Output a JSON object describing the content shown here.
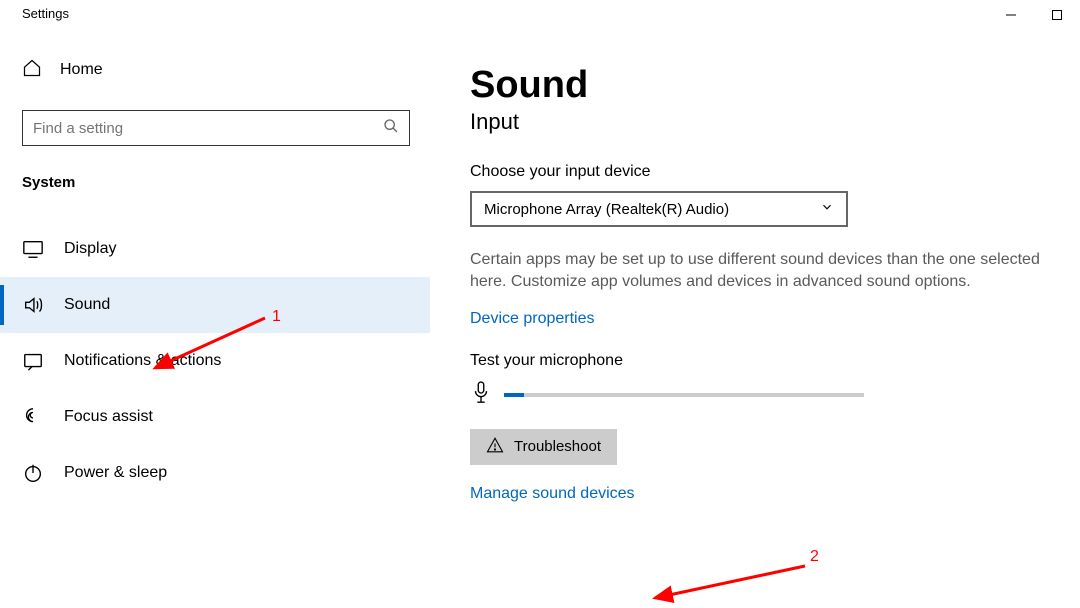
{
  "window": {
    "title": "Settings"
  },
  "sidebar": {
    "home": "Home",
    "search_placeholder": "Find a setting",
    "category": "System",
    "items": [
      {
        "label": "Display"
      },
      {
        "label": "Sound"
      },
      {
        "label": "Notifications & actions"
      },
      {
        "label": "Focus assist"
      },
      {
        "label": "Power & sleep"
      }
    ]
  },
  "main": {
    "title": "Sound",
    "subtitle": "Input",
    "choose_label": "Choose your input device",
    "selected_device": "Microphone Array (Realtek(R) Audio)",
    "help_text": "Certain apps may be set up to use different sound devices than the one selected here. Customize app volumes and devices in advanced sound options.",
    "link_device_properties": "Device properties",
    "test_label": "Test your microphone",
    "troubleshoot": "Troubleshoot",
    "manage_link": "Manage sound devices"
  },
  "annotations": {
    "a1": "1",
    "a2": "2"
  }
}
